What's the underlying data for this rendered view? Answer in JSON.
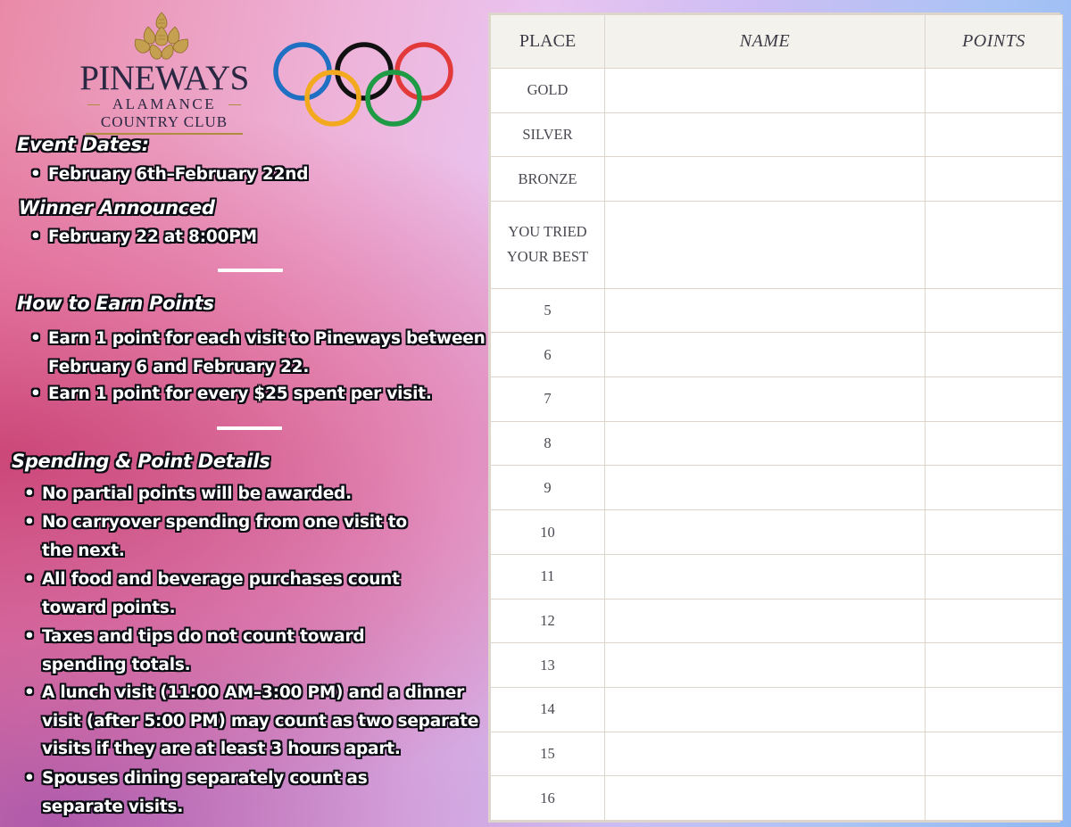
{
  "logo": {
    "brand": "PINEWAYS",
    "line1": "ALAMANCE",
    "line2": "COUNTRY CLUB",
    "crest_icon": "pinecone-crest-icon",
    "rings_icon": "olympic-rings-icon",
    "ring_colors": [
      "#1f6fc2",
      "#111111",
      "#e23a3a",
      "#f3a91d",
      "#1f9b45"
    ]
  },
  "sections": {
    "event_dates": {
      "heading": "Event Dates:",
      "items": [
        "February 6th–February 22nd"
      ]
    },
    "winner": {
      "heading": "Winner Announced",
      "items": [
        "February 22 at 8:00PM"
      ]
    },
    "earn": {
      "heading": "How to Earn Points",
      "items": [
        [
          "Earn 1 point for each visit to Pineways between",
          "February 6 and February 22."
        ],
        [
          "Earn 1 point for every $25 spent per visit."
        ]
      ]
    },
    "details": {
      "heading": "Spending & Point Details",
      "items": [
        [
          "No partial points will be awarded."
        ],
        [
          "No carryover spending from one visit to",
          "the next."
        ],
        [
          "All food and beverage purchases count",
          "toward points."
        ],
        [
          "Taxes and tips do not count toward",
          "spending totals."
        ],
        [
          "A lunch visit (11:00 AM–3:00 PM) and a dinner",
          "visit (after 5:00 PM) may count as two separate",
          "visits if they are at least 3 hours apart."
        ],
        [
          "Spouses dining separately count as",
          "separate visits."
        ]
      ]
    }
  },
  "table": {
    "headers": [
      "PLACE",
      "NAME",
      "POINTS"
    ],
    "rows": [
      [
        "GOLD"
      ],
      [
        "SILVER"
      ],
      [
        "BRONZE"
      ],
      [
        "YOU TRIED",
        "YOUR BEST"
      ],
      [
        "5"
      ],
      [
        "6"
      ],
      [
        "7"
      ],
      [
        "8"
      ],
      [
        "9"
      ],
      [
        "10"
      ],
      [
        "11"
      ],
      [
        "12"
      ],
      [
        "13"
      ],
      [
        "14"
      ],
      [
        "15"
      ],
      [
        "16"
      ]
    ]
  }
}
